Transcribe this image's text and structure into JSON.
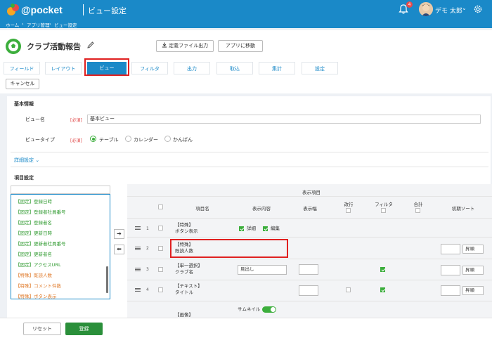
{
  "header": {
    "brand": "@pocket",
    "page_title": "ビュー設定",
    "notification_count": "4",
    "user_name": "デモ 太郎",
    "user_chevron": "⌄"
  },
  "breadcrumb": [
    "ホーム",
    "›",
    "アプリ管理",
    "›",
    "ビュー設定"
  ],
  "app": {
    "title": "クラブ活動報告",
    "export_label": "定義ファイル出力",
    "move_label": "アプリに移動"
  },
  "tabs": [
    {
      "label": "フィールド",
      "active": false
    },
    {
      "label": "レイアウト",
      "active": false
    },
    {
      "label": "ビュー",
      "active": true
    },
    {
      "label": "フィルタ",
      "active": false
    },
    {
      "label": "出力",
      "active": false
    },
    {
      "label": "取込",
      "active": false
    },
    {
      "label": "集計",
      "active": false
    },
    {
      "label": "設定",
      "active": false
    }
  ],
  "cancel_label": "キャンセル",
  "basic": {
    "section": "基本情報",
    "name_label": "ビュー名",
    "required": "[必須]",
    "name_value": "基本ビュー",
    "type_label": "ビュータイプ",
    "type_options": [
      {
        "label": "テーブル",
        "checked": true
      },
      {
        "label": "カレンダー",
        "checked": false
      },
      {
        "label": "かんばん",
        "checked": false
      }
    ]
  },
  "detail_label": "詳細設定",
  "detail_chevron": "⌄",
  "items_section": "項目設定",
  "field_list": [
    {
      "label": "【固定】登録日時",
      "kind": "green"
    },
    {
      "label": "【固定】登録者社員番号",
      "kind": "green"
    },
    {
      "label": "【固定】登録者名",
      "kind": "green"
    },
    {
      "label": "【固定】更新日時",
      "kind": "green"
    },
    {
      "label": "【固定】更新者社員番号",
      "kind": "green"
    },
    {
      "label": "【固定】更新者名",
      "kind": "green"
    },
    {
      "label": "【固定】アクセスURL",
      "kind": "green"
    },
    {
      "label": "【特殊】既読人数",
      "kind": "orange"
    },
    {
      "label": "【特殊】コメント件数",
      "kind": "orange"
    },
    {
      "label": "【特殊】ボタン表示",
      "kind": "orange"
    }
  ],
  "move_right": "➔",
  "move_left": "⬅",
  "table": {
    "group_header": "表示項目",
    "col_item_name": "項目名",
    "col_display": "表示内容",
    "col_width": "表示幅",
    "col_wrap": "改行",
    "col_filter": "フィルタ",
    "col_total": "合計",
    "col_sort": "初期ソート",
    "rows": [
      {
        "num": "1",
        "line1": "【特殊】",
        "line2": "ボタン表示",
        "opt1": "詳細",
        "opt2": "編集"
      },
      {
        "num": "2",
        "line1": "【特殊】",
        "line2": "既読人数",
        "sort_value": "昇順"
      },
      {
        "num": "3",
        "line1": "【単一選択】",
        "line2": "クラブ名",
        "display_value": "見出し",
        "sort_value": "昇順"
      },
      {
        "num": "4",
        "line1": "【テキスト】",
        "line2": "タイトル",
        "sort_value": "昇順"
      }
    ],
    "thumbnail_label": "サムネイル",
    "partial_row_text": "【画像】"
  },
  "footer": {
    "reset_label": "リセット",
    "save_label": "登録"
  },
  "colors": {
    "accent": "#1a89c8",
    "highlight": "#e02020",
    "green": "#3cae3c",
    "save": "#2a8f3a"
  },
  "icons": [
    "logo-icon",
    "bell-icon",
    "gear-icon",
    "pencil-icon",
    "download-icon",
    "chevron-down-icon",
    "arrow-right-icon",
    "arrow-left-icon",
    "drag-handle-icon"
  ]
}
